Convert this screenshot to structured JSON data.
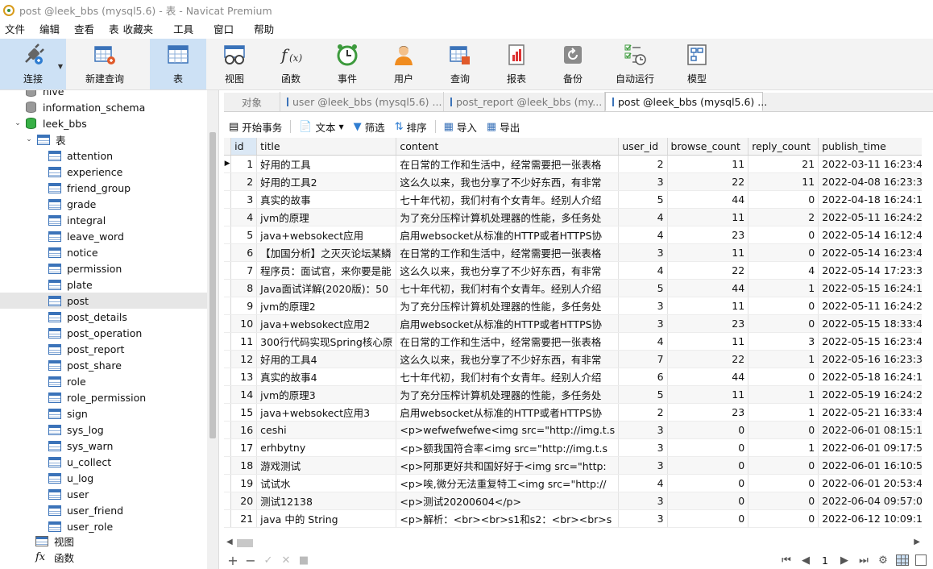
{
  "window": {
    "title": "post @leek_bbs (mysql5.6) - 表 - Navicat Premium"
  },
  "menu": [
    "文件",
    "编辑",
    "查看",
    "表",
    "收藏夹",
    "工具",
    "窗口",
    "帮助"
  ],
  "toolbar": {
    "connect": "连接",
    "new_query": "新建查询",
    "table": "表",
    "view": "视图",
    "function": "函数",
    "event": "事件",
    "user": "用户",
    "query": "查询",
    "report": "报表",
    "backup": "备份",
    "autorun": "自动运行",
    "model": "模型"
  },
  "sidebar": {
    "top_items": [
      {
        "label": "hive",
        "type": "db"
      },
      {
        "label": "information_schema",
        "type": "db"
      },
      {
        "label": "leek_bbs",
        "type": "db-open"
      },
      {
        "label": "表",
        "type": "folder"
      }
    ],
    "tables": [
      "attention",
      "experience",
      "friend_group",
      "grade",
      "integral",
      "leave_word",
      "notice",
      "permission",
      "plate",
      "post",
      "post_details",
      "post_operation",
      "post_report",
      "post_share",
      "role",
      "role_permission",
      "sign",
      "sys_log",
      "sys_warn",
      "u_collect",
      "u_log",
      "user",
      "user_friend",
      "user_role"
    ],
    "selected": "post",
    "bottom_items": [
      "视图",
      "函数"
    ]
  },
  "tabs": {
    "objects": "对象",
    "items": [
      "user @leek_bbs (mysql5.6) ...",
      "post_report @leek_bbs (my...",
      "post @leek_bbs (mysql5.6) ..."
    ]
  },
  "subtoolbar": {
    "begin_transaction": "开始事务",
    "text": "文本",
    "filter": "筛选",
    "sort": "排序",
    "import": "导入",
    "export": "导出"
  },
  "grid": {
    "columns": [
      "id",
      "title",
      "content",
      "user_id",
      "browse_count",
      "reply_count",
      "publish_time"
    ],
    "rows": [
      [
        "1",
        "好用的工具",
        "在日常的工作和生活中，经常需要把一张表格",
        "2",
        "11",
        "21",
        "2022-03-11 16:23:41"
      ],
      [
        "2",
        "好用的工具2",
        "这么久以来，我也分享了不少好东西，有非常",
        "3",
        "22",
        "11",
        "2022-04-08 16:23:30"
      ],
      [
        "3",
        "真实的故事",
        "七十年代初，我们村有个女青年。经别人介绍",
        "5",
        "44",
        "0",
        "2022-04-18 16:24:11"
      ],
      [
        "4",
        "jvm的原理",
        "为了充分压榨计算机处理器的性能，多任务处",
        "4",
        "11",
        "2",
        "2022-05-11 16:24:21"
      ],
      [
        "5",
        "java+websokect应用",
        "启用websocket从标准的HTTP或者HTTPS协",
        "4",
        "23",
        "0",
        "2022-05-14 16:12:49"
      ],
      [
        "6",
        "【加国分析】之灭灭论坛某鳞",
        "在日常的工作和生活中，经常需要把一张表格",
        "3",
        "11",
        "0",
        "2022-05-14 16:23:41"
      ],
      [
        "7",
        "程序员：面试官，来你要是能",
        "这么久以来，我也分享了不少好东西，有非常",
        "4",
        "22",
        "4",
        "2022-05-14 17:23:30"
      ],
      [
        "8",
        "Java面试详解(2020版)：50",
        "七十年代初，我们村有个女青年。经别人介绍",
        "5",
        "44",
        "1",
        "2022-05-15 16:24:11"
      ],
      [
        "9",
        "jvm的原理2",
        "为了充分压榨计算机处理器的性能，多任务处",
        "3",
        "11",
        "0",
        "2022-05-11 16:24:21"
      ],
      [
        "10",
        "java+websokect应用2",
        "启用websocket从标准的HTTP或者HTTPS协",
        "3",
        "23",
        "0",
        "2022-05-15 18:33:49"
      ],
      [
        "11",
        "300行代码实现Spring核心原",
        "在日常的工作和生活中，经常需要把一张表格",
        "4",
        "11",
        "3",
        "2022-05-15 16:23:41"
      ],
      [
        "12",
        "好用的工具4",
        "这么久以来，我也分享了不少好东西，有非常",
        "7",
        "22",
        "1",
        "2022-05-16 16:23:30"
      ],
      [
        "13",
        "真实的故事4",
        "七十年代初，我们村有个女青年。经别人介绍",
        "6",
        "44",
        "0",
        "2022-05-18 16:24:11"
      ],
      [
        "14",
        "jvm的原理3",
        "为了充分压榨计算机处理器的性能，多任务处",
        "5",
        "11",
        "1",
        "2022-05-19 16:24:21"
      ],
      [
        "15",
        "java+websokect应用3",
        "启用websocket从标准的HTTP或者HTTPS协",
        "2",
        "23",
        "1",
        "2022-05-21 16:33:49"
      ],
      [
        "16",
        "ceshi",
        "<p>wefwefwefwe<img src=\"http://img.t.s",
        "3",
        "0",
        "0",
        "2022-06-01 08:15:17"
      ],
      [
        "17",
        "erhbytny",
        "<p>额我国符合率<img src=\"http://img.t.s",
        "3",
        "0",
        "1",
        "2022-06-01 09:17:55"
      ],
      [
        "18",
        "游戏测试",
        "<p>阿那更好共和国好好于<img src=\"http:",
        "3",
        "0",
        "0",
        "2022-06-01 16:10:51"
      ],
      [
        "19",
        "试试水",
        "<p>唉,微分无法重复特工<img src=\"http://",
        "4",
        "0",
        "0",
        "2022-06-01 20:53:43"
      ],
      [
        "20",
        "测试12138",
        "<p>测试20200604</p>",
        "3",
        "0",
        "0",
        "2022-06-04 09:57:08"
      ],
      [
        "21",
        "java 中的 String",
        "<p>解析：<br><br>s1和s2：<br><br>s",
        "3",
        "0",
        "0",
        "2022-06-12 10:09:17"
      ]
    ]
  },
  "pager": {
    "page": "1"
  }
}
